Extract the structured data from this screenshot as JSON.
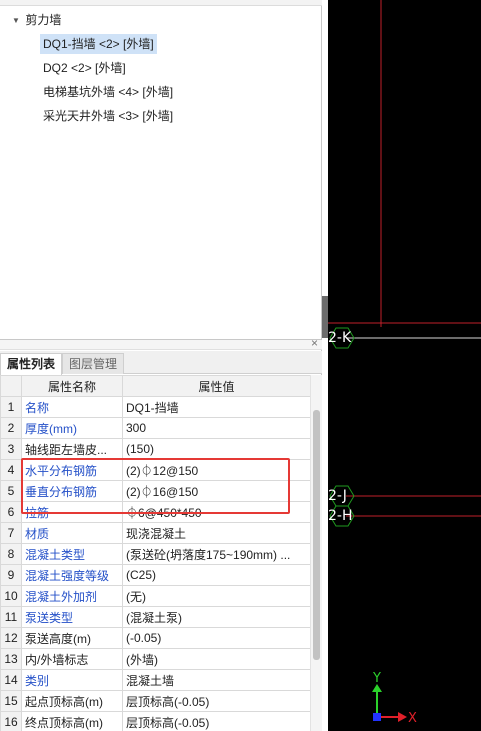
{
  "tree": {
    "group_label": "剪力墙",
    "items": [
      {
        "label": "DQ1-挡墙 <2> [外墙]",
        "selected": true
      },
      {
        "label": "DQ2 <2> [外墙]",
        "selected": false
      },
      {
        "label": "电梯基坑外墙 <4> [外墙]",
        "selected": false
      },
      {
        "label": "采光天井外墙 <3> [外墙]",
        "selected": false
      }
    ]
  },
  "prop_panel": {
    "close_glyph": "×",
    "tabs": [
      {
        "label": "属性列表",
        "active": true
      },
      {
        "label": "图层管理",
        "active": false
      }
    ],
    "columns": [
      "属性名称",
      "属性值"
    ],
    "rows": [
      {
        "no": "1",
        "name": "名称",
        "value": "DQ1-挡墙",
        "blue": true
      },
      {
        "no": "2",
        "name": "厚度(mm)",
        "value": "300",
        "blue": true
      },
      {
        "no": "3",
        "name": "轴线距左墙皮...",
        "value": "(150)",
        "blue": false
      },
      {
        "no": "4",
        "name": "水平分布钢筋",
        "value": "(2)⏀12@150",
        "blue": true
      },
      {
        "no": "5",
        "name": "垂直分布钢筋",
        "value": "(2)⏀16@150",
        "blue": true
      },
      {
        "no": "6",
        "name": "拉筋",
        "value": "⏀6@450*450",
        "blue": true
      },
      {
        "no": "7",
        "name": "材质",
        "value": "现浇混凝土",
        "blue": true
      },
      {
        "no": "8",
        "name": "混凝土类型",
        "value": "(泵送砼(坍落度175~190mm) ...",
        "blue": true
      },
      {
        "no": "9",
        "name": "混凝土强度等级",
        "value": "(C25)",
        "blue": true
      },
      {
        "no": "10",
        "name": "混凝土外加剂",
        "value": "(无)",
        "blue": true
      },
      {
        "no": "11",
        "name": "泵送类型",
        "value": "(混凝土泵)",
        "blue": true
      },
      {
        "no": "12",
        "name": "泵送高度(m)",
        "value": "(-0.05)",
        "blue": false
      },
      {
        "no": "13",
        "name": "内/外墙标志",
        "value": "(外墙)",
        "blue": false
      },
      {
        "no": "14",
        "name": "类别",
        "value": "混凝土墙",
        "blue": true
      },
      {
        "no": "15",
        "name": "起点顶标高(m)",
        "value": "层顶标高(-0.05)",
        "blue": false
      },
      {
        "no": "16",
        "name": "终点顶标高(m)",
        "value": "层顶标高(-0.05)",
        "blue": false
      }
    ]
  },
  "canvas": {
    "axis_labels": [
      "2-K",
      "2-J",
      "2-H"
    ],
    "ucs_x": "X",
    "ucs_y": "Y",
    "colors": {
      "background": "#000000",
      "red_line": "#c0202a",
      "axis_line": "#d8d8d8",
      "bubble": "#1f9a1f",
      "x_arrow": "#e0202a",
      "y_arrow": "#2bd12b",
      "origin": "#2233ff"
    }
  },
  "colors": {
    "selected_bg": "#cfe2f7",
    "highlight_border": "#e53935",
    "blue_label": "#2450c8"
  }
}
